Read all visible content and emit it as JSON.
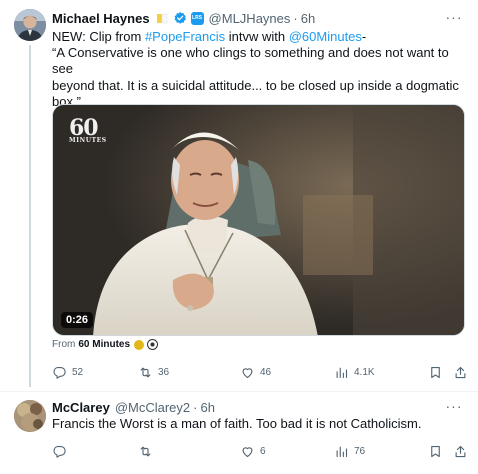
{
  "tweet1": {
    "author_name": "Michael Haynes",
    "handle": "@MLJHaynes",
    "time": "6h",
    "text_lines": [
      "A Conservative is one who clings to something and does not want to see",
      "beyond that. It is a suicidal attitude... to be closed up inside a dogmatic",
      "box.”"
    ],
    "text_prefix": "NEW: Clip from ",
    "hashtag": "#PopeFrancis",
    "text_mid": " intvw with ",
    "mention": "@60Minutes",
    "text_suffix": "-",
    "quote_open": "“",
    "video_duration": "0:26",
    "logo_big": "60",
    "logo_small": "MINUTES",
    "from_label": "From",
    "from_source": "60 Minutes",
    "stats": {
      "replies": "52",
      "retweets": "36",
      "likes": "46",
      "views": "4.1K"
    }
  },
  "tweet2": {
    "author_name": "McClarey",
    "handle": "@McClarey2",
    "time": "6h",
    "text": "Francis the Worst is a man of faith.  Too bad it is not Catholicism.",
    "stats": {
      "replies": "",
      "retweets": "",
      "likes": "6",
      "views": "76"
    }
  },
  "ui": {
    "dot": "·",
    "more": "···"
  },
  "colors": {
    "link": "#1d9bf0",
    "muted": "#536471",
    "text": "#0f1419",
    "verified": "#1d9bf0",
    "gold": "#e2b719"
  },
  "icons": [
    "reply-icon",
    "retweet-icon",
    "like-icon",
    "views-icon",
    "bookmark-icon",
    "share-icon",
    "verified-icon",
    "more-icon"
  ]
}
